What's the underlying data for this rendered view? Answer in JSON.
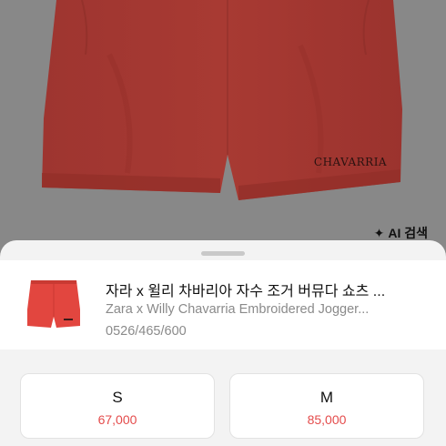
{
  "hero": {
    "brand_print": "CHAVARRIA",
    "ai_search_label": "AI 검색",
    "ai_search_icon": "sparkle-icon",
    "product_color": "#a83a33",
    "background_color": "#888888"
  },
  "product": {
    "title_ko": "자라 x 윌리 차바리아 자수 조거 버뮤다 쇼츠 ...",
    "title_en": "Zara x Willy Chavarria Embroidered Jogger...",
    "code": "0526/465/600",
    "thumbnail_color": "#e2463f"
  },
  "sizes": [
    {
      "label": "S",
      "price": "67,000"
    },
    {
      "label": "M",
      "price": "85,000"
    }
  ],
  "accent_price_color": "#e44b4b"
}
